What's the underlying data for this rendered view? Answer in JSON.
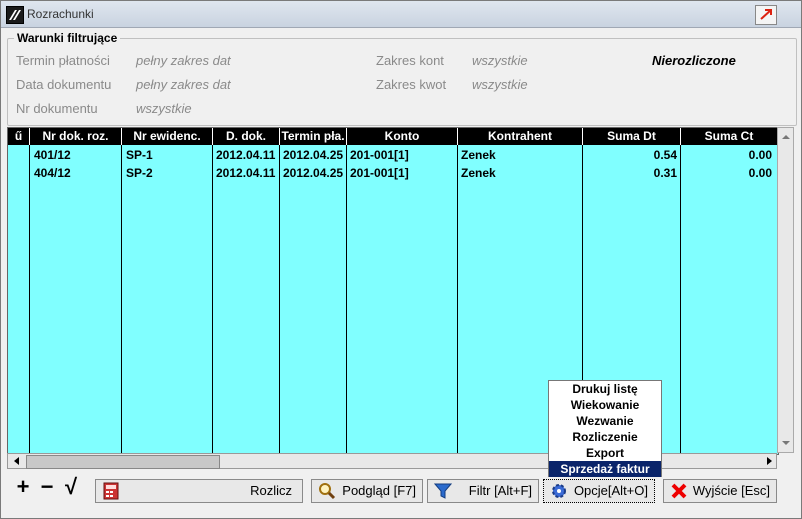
{
  "window": {
    "title": "Rozrachunki"
  },
  "filters": {
    "group_title": "Warunki filtrujące",
    "termin_label": "Termin płatności",
    "termin_value": "pełny zakres dat",
    "data_label": "Data dokumentu",
    "data_value": "pełny zakres dat",
    "nr_label": "Nr dokumentu",
    "nr_value": "wszystkie",
    "konta_label": "Zakres kont",
    "konta_value": "wszystkie",
    "kwot_label": "Zakres kwot",
    "kwot_value": "wszystkie",
    "status": "Nierozliczone"
  },
  "table": {
    "columns": [
      "ű",
      "Nr dok. roz.",
      "Nr ewidenc.",
      "D. dok.",
      "Termin pła.",
      "Konto",
      "Kontrahent",
      "Suma Dt",
      "Suma Ct"
    ],
    "rows": [
      [
        "",
        "401/12",
        "SP-1",
        "2012.04.11",
        "2012.04.25",
        "201-001[1]",
        "Zenek",
        "0.54",
        "0.00"
      ],
      [
        "",
        "404/12",
        "SP-2",
        "2012.04.11",
        "2012.04.25",
        "201-001[1]",
        "Zenek",
        "0.31",
        "0.00"
      ]
    ]
  },
  "context_menu": {
    "items": [
      "Drukuj listę",
      "Wiekowanie",
      "Wezwanie",
      "Rozliczenie",
      "Export",
      "Sprzedaż faktur"
    ],
    "selected": "Sprzedaż faktur"
  },
  "toolbar": {
    "add_symbol": "+",
    "remove_symbol": "−",
    "check_symbol": "√",
    "rozlicz": "Rozlicz",
    "podglad": "Podgląd  [F7]",
    "filtr": "Filtr  [Alt+F]",
    "opcje": "Opcje[Alt+O]",
    "wyjscie": "Wyjście  [Esc]"
  },
  "colors": {
    "grid_bg": "#80ffff",
    "header_bg": "#000000",
    "menu_selected": "#0a246a"
  }
}
